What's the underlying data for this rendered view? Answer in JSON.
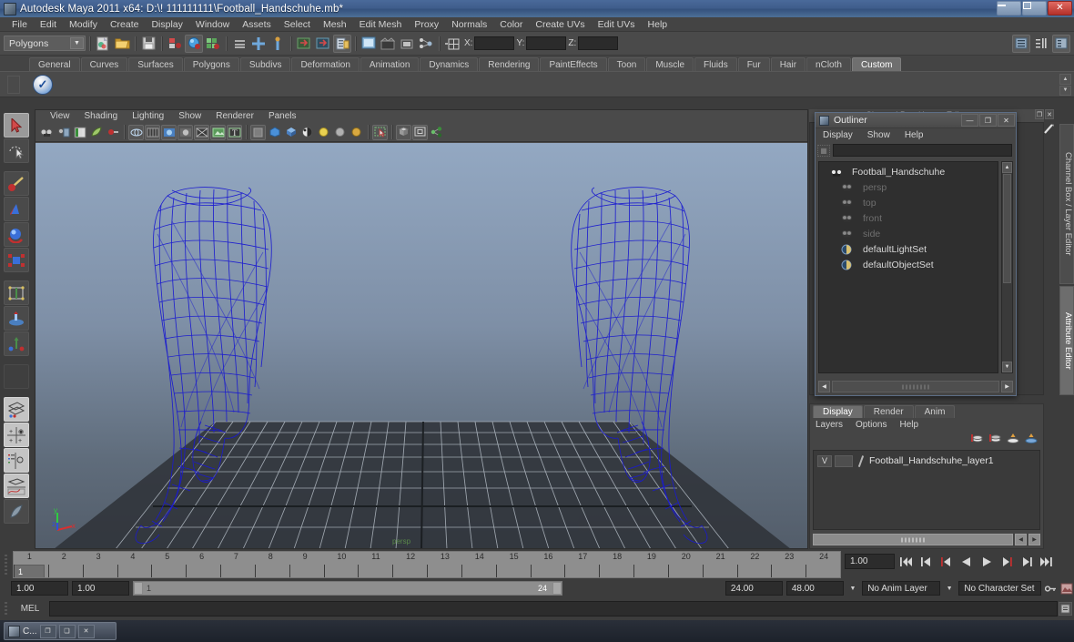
{
  "window": {
    "title": "Autodesk Maya 2011 x64: D:\\! 111111111\\Football_Handschuhe.mb*",
    "minimize": "—",
    "maximize": "❐",
    "close": "✕"
  },
  "menubar": {
    "items": [
      "File",
      "Edit",
      "Modify",
      "Create",
      "Display",
      "Window",
      "Assets",
      "Select",
      "Mesh",
      "Edit Mesh",
      "Proxy",
      "Normals",
      "Color",
      "Create UVs",
      "Edit UVs",
      "Help"
    ]
  },
  "toolbar": {
    "menuset": "Polygons",
    "coords": {
      "x_label": "X:",
      "y_label": "Y:",
      "z_label": "Z:",
      "x_value": "",
      "y_value": "",
      "z_value": ""
    }
  },
  "shelf": {
    "tabs": [
      "General",
      "Curves",
      "Surfaces",
      "Polygons",
      "Subdivs",
      "Deformation",
      "Animation",
      "Dynamics",
      "Rendering",
      "PaintEffects",
      "Toon",
      "Muscle",
      "Fluids",
      "Fur",
      "Hair",
      "nCloth",
      "Custom"
    ],
    "active_tab": "Custom"
  },
  "viewport": {
    "menus": [
      "View",
      "Shading",
      "Lighting",
      "Show",
      "Renderer",
      "Panels"
    ],
    "axis": {
      "x": "x",
      "y": "y",
      "z": "z"
    }
  },
  "channelbox": {
    "header": "Channel Box / Layer Editor",
    "vertical_tabs": [
      "Channel Box / Layer Editor",
      "Attribute Editor"
    ],
    "active_vertical_tab": "Attribute Editor"
  },
  "outliner": {
    "title": "Outliner",
    "window_buttons": {
      "minimize": "—",
      "maximize": "❐",
      "close": "✕"
    },
    "menus": [
      "Display",
      "Show",
      "Help"
    ],
    "search_value": "",
    "items": [
      {
        "label": "Football_Handschuhe",
        "dim": false,
        "icon": "mesh-icon"
      },
      {
        "label": "persp",
        "dim": true,
        "icon": "camera-icon"
      },
      {
        "label": "top",
        "dim": true,
        "icon": "camera-icon"
      },
      {
        "label": "front",
        "dim": true,
        "icon": "camera-icon"
      },
      {
        "label": "side",
        "dim": true,
        "icon": "camera-icon"
      },
      {
        "label": "defaultLightSet",
        "dim": false,
        "icon": "set-icon"
      },
      {
        "label": "defaultObjectSet",
        "dim": false,
        "icon": "set-icon"
      }
    ]
  },
  "layer_editor": {
    "tabs": [
      "Display",
      "Render",
      "Anim"
    ],
    "active_tab": "Display",
    "menus": [
      "Layers",
      "Options",
      "Help"
    ],
    "layers": [
      {
        "visibility": "V",
        "type": "",
        "name": "Football_Handschuhe_layer1"
      }
    ]
  },
  "timeline": {
    "current_frame": "1",
    "ticks": [
      "1",
      "2",
      "3",
      "4",
      "5",
      "6",
      "7",
      "8",
      "9",
      "10",
      "11",
      "12",
      "13",
      "14",
      "15",
      "16",
      "17",
      "18",
      "19",
      "20",
      "21",
      "22",
      "23",
      "24"
    ],
    "playback_field": "1.00"
  },
  "range": {
    "start": "1.00",
    "start_range": "1.00",
    "slider_min": "1",
    "slider_max": "24",
    "end_range": "24.00",
    "end": "48.00",
    "anim_layer": "No Anim Layer",
    "character_set": "No Character Set"
  },
  "command_line": {
    "label": "MEL",
    "value": ""
  },
  "taskbar": {
    "item_label": "C...",
    "minimize": "❐",
    "restore": "❏",
    "close": "✕"
  },
  "colors": {
    "title_bar": "#3f5d8c",
    "wireframe": "#1818cf",
    "accent_close": "#b4312a",
    "panel_bg": "#3c3c3c",
    "viewport_top": "#8ba2bd",
    "viewport_bottom": "#5c6774"
  }
}
